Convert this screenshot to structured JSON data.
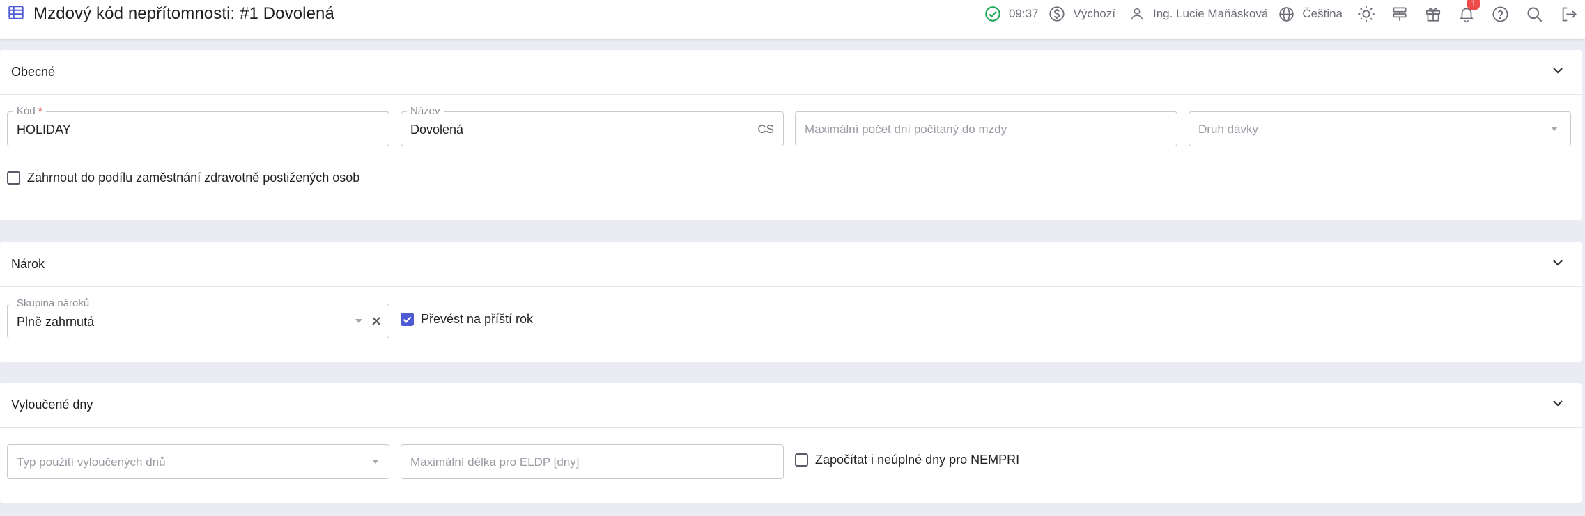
{
  "header": {
    "title": "Mzdový kód nepřítomnosti: #1 Dovolená",
    "time": "09:37",
    "currency_label": "Výchozí",
    "user_name": "Ing. Lucie Maňásková",
    "language": "Čeština",
    "notification_count": "1"
  },
  "sections": {
    "general": {
      "title": "Obecné",
      "code": {
        "label": "Kód",
        "required_mark": "*",
        "value": "HOLIDAY"
      },
      "name": {
        "label": "Název",
        "value": "Dovolená",
        "lang_suffix": "CS"
      },
      "max_days": {
        "placeholder": "Maximální počet dní počítaný do mzdy"
      },
      "benefit_type": {
        "placeholder": "Druh dávky"
      },
      "disabled_share": {
        "label": "Zahrnout do podílu zaměstnání zdravotně postižených osob",
        "checked": false
      }
    },
    "entitlement": {
      "title": "Nárok",
      "group": {
        "label": "Skupina nároků",
        "value": "Plně zahrnutá"
      },
      "carry_over": {
        "label": "Převést na příští rok",
        "checked": true
      }
    },
    "excluded": {
      "title": "Vyloučené dny",
      "usage_type": {
        "placeholder": "Typ použití vyloučených dnů"
      },
      "max_length": {
        "placeholder": "Maximální délka pro ELDP [dny]"
      },
      "partial_days": {
        "label": "Započítat i neúplné dny pro NEMPRI",
        "checked": false
      }
    }
  },
  "colors": {
    "accent": "#4f5bd5",
    "success": "#22a85a",
    "badge": "#ef4b4b",
    "background": "#ebebf3"
  },
  "icons": {
    "title": "table-icon",
    "status": "check-circle-icon",
    "currency": "dollar-circle-icon",
    "user": "user-icon",
    "language": "globe-icon",
    "theme": "sun-icon",
    "layout": "layout-icon",
    "gift": "gift-icon",
    "notifications": "bell-icon",
    "help": "help-icon",
    "search": "search-icon",
    "logout": "logout-icon"
  }
}
